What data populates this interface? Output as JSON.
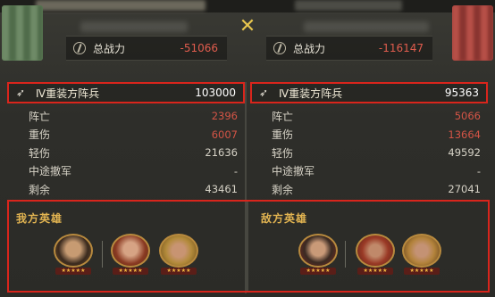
{
  "power": {
    "left": {
      "label": "总战力",
      "value": "-51066"
    },
    "right": {
      "label": "总战力",
      "value": "-116147"
    }
  },
  "left_panel": {
    "unit": {
      "name": "Ⅳ重装方阵兵",
      "count": "103000"
    },
    "stats": [
      {
        "label": "阵亡",
        "value": "2396",
        "highlight": true
      },
      {
        "label": "重伤",
        "value": "6007",
        "highlight": true
      },
      {
        "label": "轻伤",
        "value": "21636",
        "highlight": false
      },
      {
        "label": "中途撤军",
        "value": "-",
        "highlight": false
      },
      {
        "label": "剩余",
        "value": "43461",
        "highlight": false
      }
    ]
  },
  "right_panel": {
    "unit": {
      "name": "Ⅳ重装方阵兵",
      "count": "95363"
    },
    "stats": [
      {
        "label": "阵亡",
        "value": "5066",
        "highlight": true
      },
      {
        "label": "重伤",
        "value": "13664",
        "highlight": true
      },
      {
        "label": "轻伤",
        "value": "49592",
        "highlight": false
      },
      {
        "label": "中途撤军",
        "value": "-",
        "highlight": false
      },
      {
        "label": "剩余",
        "value": "27041",
        "highlight": false
      }
    ]
  },
  "heroes": {
    "left_title": "我方英雄",
    "right_title": "敌方英雄",
    "stars_text": "★★★★★"
  },
  "colors": {
    "highlight_box": "#d9251c",
    "loss_red": "#d35446",
    "power_red": "#e05c4e",
    "hero_title": "#e2b451"
  },
  "icons": {
    "vs": "✕",
    "unit": "➶"
  }
}
